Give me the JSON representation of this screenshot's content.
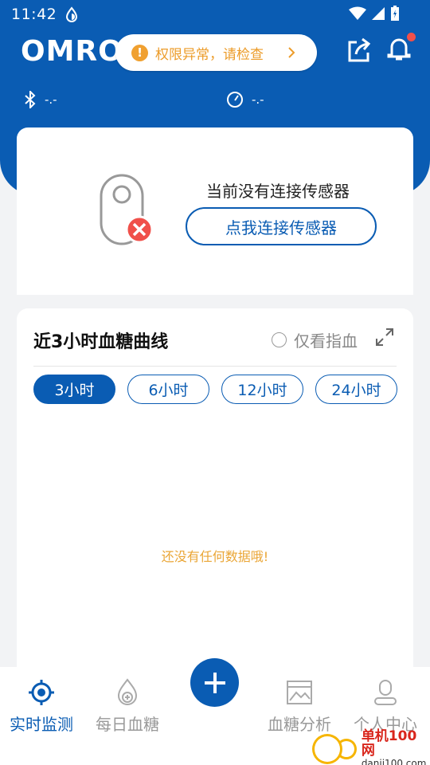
{
  "status_bar": {
    "time": "11:42"
  },
  "header": {
    "logo": "OMRON",
    "alert": {
      "icon": "exclamation-icon",
      "glyph": "!",
      "text": "权限异常，请检查"
    },
    "bluetooth_value": "-.-",
    "gauge_value": "-.-"
  },
  "sensor_card": {
    "message": "当前没有连接传感器",
    "connect_label": "点我连接传感器"
  },
  "chart_card": {
    "title": "近3小时血糖曲线",
    "finger_only_label": "仅看指血",
    "range_tabs": [
      {
        "label": "3小时",
        "active": true
      },
      {
        "label": "6小时",
        "active": false
      },
      {
        "label": "12小时",
        "active": false
      },
      {
        "label": "24小时",
        "active": false
      }
    ],
    "empty_message": "还没有任何数据哦!"
  },
  "bottom_nav": {
    "items": [
      {
        "label": "实时监测",
        "icon": "target-icon",
        "active": true
      },
      {
        "label": "每日血糖",
        "icon": "drop-plus-icon",
        "active": false
      },
      {
        "label": "血糖分析",
        "icon": "chart-image-icon",
        "active": false
      },
      {
        "label": "个人中心",
        "icon": "person-icon",
        "active": false
      }
    ]
  },
  "watermark": {
    "name": "单机100网",
    "url": "danji100.com"
  },
  "colors": {
    "primary": "#0a5cb3",
    "warning": "#ec9c2a",
    "danger": "#f0504a"
  }
}
